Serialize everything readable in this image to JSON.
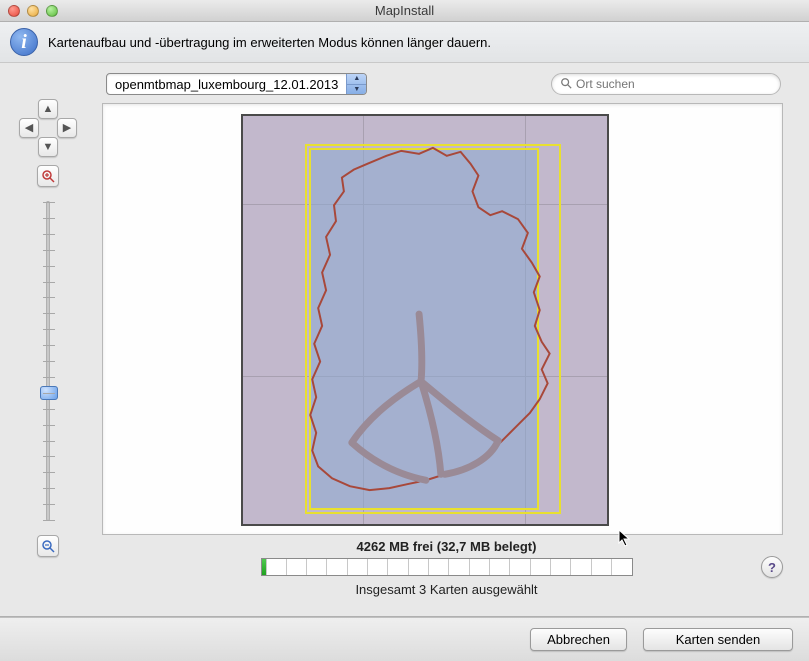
{
  "window": {
    "title": "MapInstall"
  },
  "info": {
    "message": "Kartenaufbau und -übertragung im erweiterten Modus können länger dauern."
  },
  "toolbar": {
    "map_dropdown_selected": "openmtbmap_luxembourg_12.01.2013",
    "search_placeholder": "Ort suchen"
  },
  "status": {
    "capacity_text": "4262 MB frei (32,7 MB belegt)",
    "selection_text": "Insgesamt 3 Karten ausgewählt"
  },
  "footer": {
    "cancel_label": "Abbrechen",
    "send_label": "Karten senden"
  },
  "icons": {
    "help": "?",
    "search": "🔍"
  }
}
